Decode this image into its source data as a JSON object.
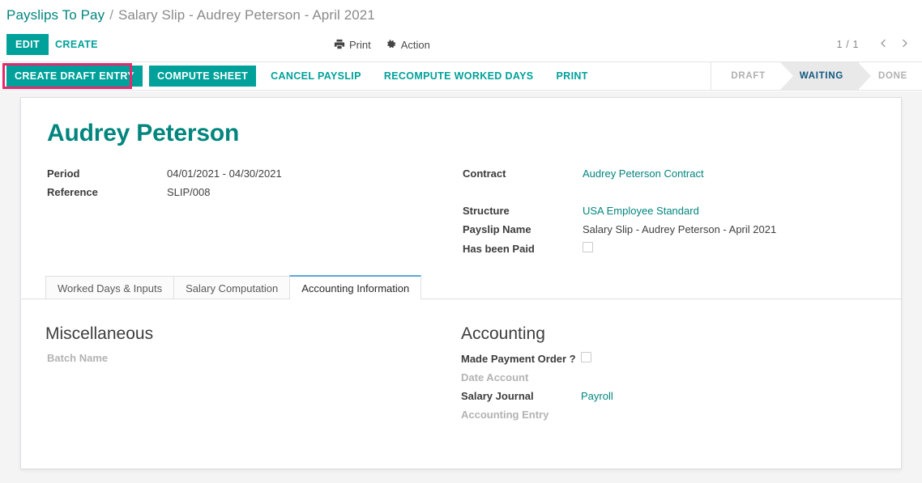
{
  "breadcrumb": {
    "root": "Payslips To Pay",
    "separator": "/",
    "current": "Salary Slip - Audrey Peterson - April 2021"
  },
  "controls": {
    "edit_label": "EDIT",
    "create_label": "CREATE",
    "print_label": "Print",
    "action_label": "Action",
    "pager_count": "1 / 1",
    "prev_icon": "chevron-left-icon",
    "next_icon": "chevron-right-icon"
  },
  "statusbar": {
    "buttons": [
      {
        "label": "CREATE DRAFT ENTRY",
        "primary": true,
        "highlighted": true
      },
      {
        "label": "COMPUTE SHEET",
        "primary": true,
        "highlighted": false
      },
      {
        "label": "CANCEL PAYSLIP",
        "primary": false,
        "highlighted": false
      },
      {
        "label": "RECOMPUTE WORKED DAYS",
        "primary": false,
        "highlighted": false
      },
      {
        "label": "PRINT",
        "primary": false,
        "highlighted": false
      }
    ],
    "stages": [
      {
        "label": "DRAFT",
        "active": false
      },
      {
        "label": "WAITING",
        "active": true
      },
      {
        "label": "DONE",
        "active": false
      }
    ],
    "highlight_color": "#e8286e",
    "accent_color": "#00a19a"
  },
  "record": {
    "title": "Audrey Peterson",
    "left_fields": [
      {
        "label": "Period",
        "value": "04/01/2021 - 04/30/2021",
        "link": false
      },
      {
        "label": "Reference",
        "value": "SLIP/008",
        "link": false
      }
    ],
    "right_fields": [
      {
        "label": "Contract",
        "value": "Audrey Peterson Contract",
        "link": true
      },
      {
        "label": "Structure",
        "value": "USA Employee Standard",
        "link": true
      },
      {
        "label": "Payslip Name",
        "value": "Salary Slip - Audrey Peterson - April 2021",
        "link": false
      },
      {
        "label": "Has been Paid",
        "value": "",
        "link": false,
        "checkbox": true,
        "checked": false
      }
    ]
  },
  "tabs": [
    {
      "label": "Worked Days & Inputs",
      "active": false
    },
    {
      "label": "Salary Computation",
      "active": false
    },
    {
      "label": "Accounting Information",
      "active": true
    }
  ],
  "tab_page": {
    "left": {
      "title": "Miscellaneous",
      "fields": [
        {
          "label": "Batch Name",
          "value": "",
          "muted": true,
          "link": false
        }
      ]
    },
    "right": {
      "title": "Accounting",
      "fields": [
        {
          "label": "Made Payment Order ?",
          "value": "",
          "muted": false,
          "link": false,
          "checkbox": true,
          "checked": false
        },
        {
          "label": "Date Account",
          "value": "",
          "muted": true,
          "link": false
        },
        {
          "label": "Salary Journal",
          "value": "Payroll",
          "muted": false,
          "link": true
        },
        {
          "label": "Accounting Entry",
          "value": "",
          "muted": true,
          "link": false
        }
      ]
    }
  }
}
